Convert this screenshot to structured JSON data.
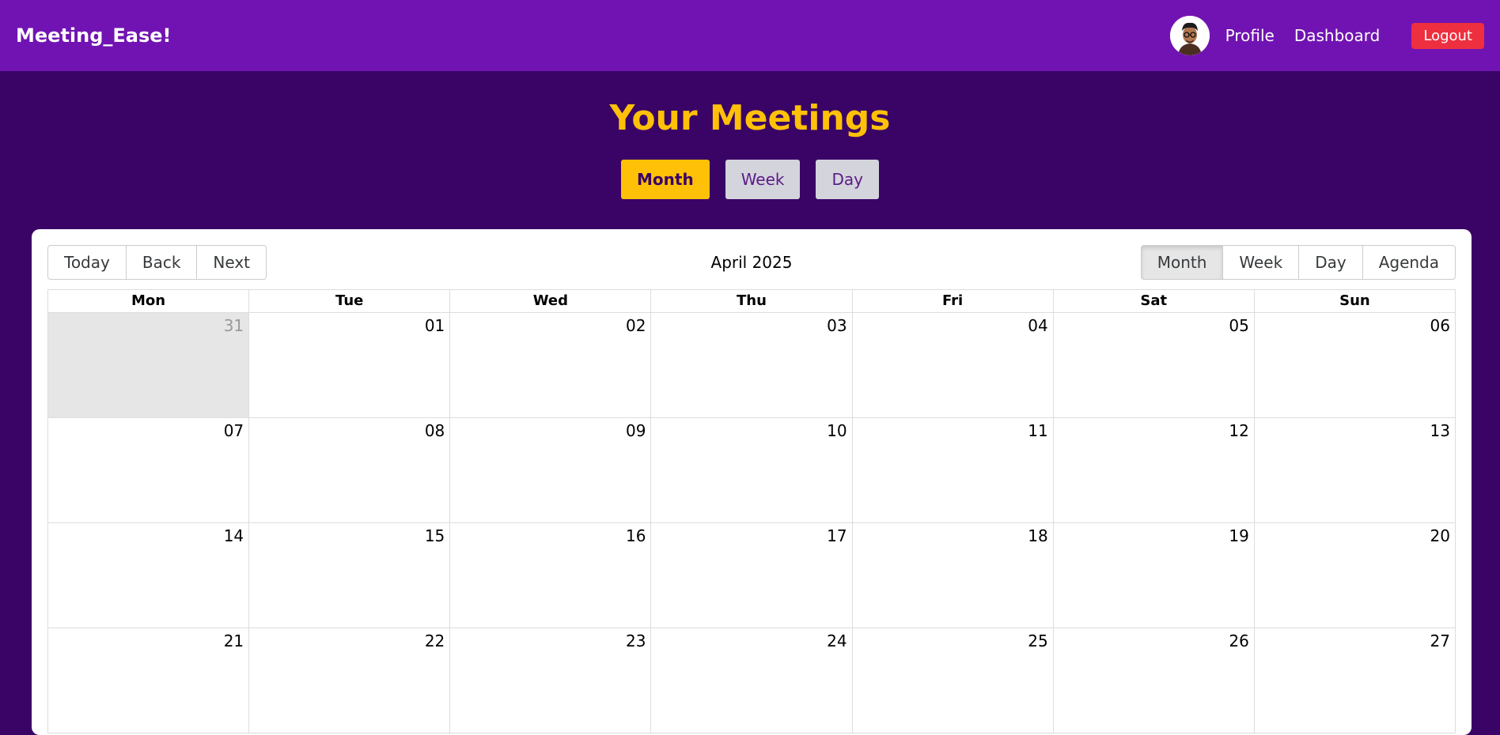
{
  "nav": {
    "brand": "Meeting_Ease!",
    "profile": "Profile",
    "dashboard": "Dashboard",
    "logout": "Logout"
  },
  "page": {
    "heading": "Your Meetings",
    "view_toggle": [
      "Month",
      "Week",
      "Day"
    ],
    "active_view": "Month"
  },
  "calendar": {
    "toolbar": {
      "today": "Today",
      "back": "Back",
      "next": "Next",
      "label": "April 2025",
      "views": [
        "Month",
        "Week",
        "Day",
        "Agenda"
      ],
      "active_view": "Month"
    },
    "weekdays": [
      "Mon",
      "Tue",
      "Wed",
      "Thu",
      "Fri",
      "Sat",
      "Sun"
    ],
    "weeks": [
      [
        "31",
        "01",
        "02",
        "03",
        "04",
        "05",
        "06"
      ],
      [
        "07",
        "08",
        "09",
        "10",
        "11",
        "12",
        "13"
      ],
      [
        "14",
        "15",
        "16",
        "17",
        "18",
        "19",
        "20"
      ],
      [
        "21",
        "22",
        "23",
        "24",
        "25",
        "26",
        "27"
      ]
    ],
    "off_range_days": [
      "31"
    ]
  },
  "colors": {
    "topbar": "#7113b2",
    "background": "#3a0366",
    "accent": "#ffc107",
    "logout": "#ee2f3f"
  }
}
